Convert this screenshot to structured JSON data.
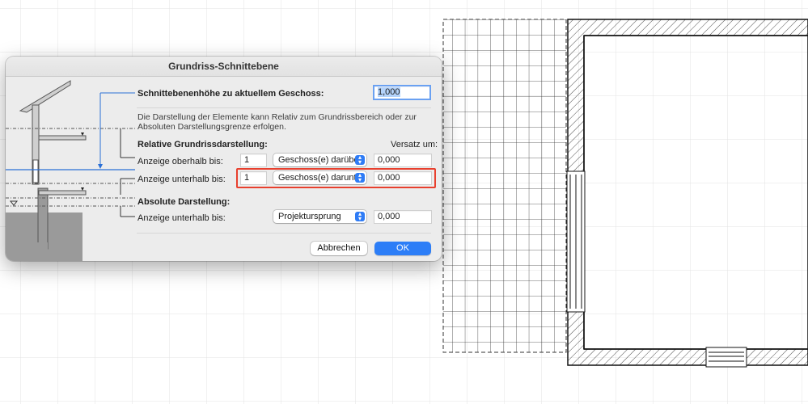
{
  "dialog": {
    "title": "Grundriss-Schnittebene",
    "cut_plane_label": "Schnittebenenhöhe zu aktuellem Geschoss:",
    "cut_plane_value": "1,000",
    "description": "Die Darstellung der Elemente kann Relativ zum Grundrissbereich oder zur Absoluten Darstellungsgrenze erfolgen.",
    "relative_heading": "Relative Grundrissdarstellung:",
    "offset_heading": "Versatz um:",
    "above": {
      "label": "Anzeige oberhalb bis:",
      "count": "1",
      "option": "Geschoss(e) darüber",
      "offset": "0,000"
    },
    "below": {
      "label": "Anzeige unterhalb bis:",
      "count": "1",
      "option": "Geschoss(e) darunter",
      "offset": "0,000"
    },
    "absolute_heading": "Absolute Darstellung:",
    "absolute_below": {
      "label": "Anzeige unterhalb bis:",
      "option": "Projektursprung",
      "offset": "0,000"
    },
    "cancel_label": "Abbrechen",
    "ok_label": "OK"
  },
  "colors": {
    "accent": "#2d7ef7",
    "highlight": "#e8402e",
    "cut_line": "#2a6fd6"
  },
  "icons": [
    "chevron-updown-icon"
  ]
}
